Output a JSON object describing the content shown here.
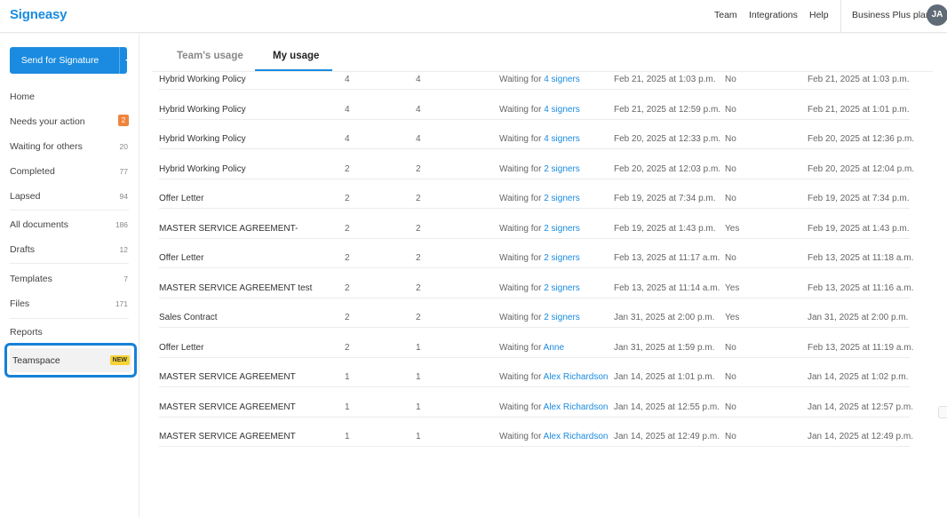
{
  "app": {
    "logo": "Signeasy",
    "nav": {
      "team": "Team",
      "integrations": "Integrations",
      "help": "Help"
    },
    "plan": "Business Plus plan",
    "avatar_initials": "JA"
  },
  "sidebar": {
    "send_button": "Send for Signature",
    "items": [
      {
        "label": "Home",
        "count": ""
      },
      {
        "label": "Needs your action",
        "count": "2"
      },
      {
        "label": "Waiting for others",
        "count": "20"
      },
      {
        "label": "Completed",
        "count": "77"
      },
      {
        "label": "Lapsed",
        "count": "94"
      },
      {
        "label": "All documents",
        "count": "186"
      },
      {
        "label": "Drafts",
        "count": "12"
      },
      {
        "label": "Templates",
        "count": "7"
      },
      {
        "label": "Files",
        "count": "171"
      },
      {
        "label": "Reports",
        "count": ""
      }
    ],
    "teamspace": {
      "label": "Teamspace",
      "badge": "NEW"
    }
  },
  "tabs": {
    "team_usage": "Team's usage",
    "my_usage": "My usage"
  },
  "colors": {
    "accent": "#1a8be0",
    "badge_orange": "#f0843c",
    "new_badge": "#f7d334",
    "highlight_border": "#1581d8"
  },
  "table": {
    "rows": [
      {
        "doc": "Hybrid Working Policy",
        "a": "4",
        "b": "4",
        "status_prefix": "Waiting for",
        "status_link": "4 signers",
        "sent": "Feb 21, 2025 at 1:03 p.m.",
        "flag": "No",
        "updated": "Feb 21, 2025 at 1:03 p.m."
      },
      {
        "doc": "Hybrid Working Policy",
        "a": "4",
        "b": "4",
        "status_prefix": "Waiting for",
        "status_link": "4 signers",
        "sent": "Feb 21, 2025 at 12:59 p.m.",
        "flag": "No",
        "updated": "Feb 21, 2025 at 1:01 p.m."
      },
      {
        "doc": "Hybrid Working Policy",
        "a": "4",
        "b": "4",
        "status_prefix": "Waiting for",
        "status_link": "4 signers",
        "sent": "Feb 20, 2025 at 12:33 p.m.",
        "flag": "No",
        "updated": "Feb 20, 2025 at 12:36 p.m."
      },
      {
        "doc": "Hybrid Working Policy",
        "a": "2",
        "b": "2",
        "status_prefix": "Waiting for",
        "status_link": "2 signers",
        "sent": "Feb 20, 2025 at 12:03 p.m.",
        "flag": "No",
        "updated": "Feb 20, 2025 at 12:04 p.m."
      },
      {
        "doc": "Offer Letter",
        "a": "2",
        "b": "2",
        "status_prefix": "Waiting for",
        "status_link": "2 signers",
        "sent": "Feb 19, 2025 at 7:34 p.m.",
        "flag": "No",
        "updated": "Feb 19, 2025 at 7:34 p.m."
      },
      {
        "doc": "MASTER SERVICE AGREEMENT-",
        "a": "2",
        "b": "2",
        "status_prefix": "Waiting for",
        "status_link": "2 signers",
        "sent": "Feb 19, 2025 at 1:43 p.m.",
        "flag": "Yes",
        "updated": "Feb 19, 2025 at 1:43 p.m."
      },
      {
        "doc": "Offer Letter",
        "a": "2",
        "b": "2",
        "status_prefix": "Waiting for",
        "status_link": "2 signers",
        "sent": "Feb 13, 2025 at 11:17 a.m.",
        "flag": "No",
        "updated": "Feb 13, 2025 at 11:18 a.m."
      },
      {
        "doc": "MASTER SERVICE AGREEMENT test",
        "a": "2",
        "b": "2",
        "status_prefix": "Waiting for",
        "status_link": "2 signers",
        "sent": "Feb 13, 2025 at 11:14 a.m.",
        "flag": "Yes",
        "updated": "Feb 13, 2025 at 11:16 a.m."
      },
      {
        "doc": "Sales Contract",
        "a": "2",
        "b": "2",
        "status_prefix": "Waiting for",
        "status_link": "2 signers",
        "sent": "Jan 31, 2025 at 2:00 p.m.",
        "flag": "Yes",
        "updated": "Jan 31, 2025 at 2:00 p.m."
      },
      {
        "doc": "Offer Letter",
        "a": "2",
        "b": "1",
        "status_prefix": "Waiting for",
        "status_link": "Anne",
        "sent": "Jan 31, 2025 at 1:59 p.m.",
        "flag": "No",
        "updated": "Feb 13, 2025 at 11:19 a.m."
      },
      {
        "doc": "MASTER SERVICE AGREEMENT",
        "a": "1",
        "b": "1",
        "status_prefix": "Waiting for",
        "status_link": "Alex Richardson",
        "sent": "Jan 14, 2025 at 1:01 p.m.",
        "flag": "No",
        "updated": "Jan 14, 2025 at 1:02 p.m."
      },
      {
        "doc": "MASTER SERVICE AGREEMENT",
        "a": "1",
        "b": "1",
        "status_prefix": "Waiting for",
        "status_link": "Alex Richardson",
        "sent": "Jan 14, 2025 at 12:55 p.m.",
        "flag": "No",
        "updated": "Jan 14, 2025 at 12:57 p.m."
      },
      {
        "doc": "MASTER SERVICE AGREEMENT",
        "a": "1",
        "b": "1",
        "status_prefix": "Waiting for",
        "status_link": "Alex Richardson",
        "sent": "Jan 14, 2025 at 12:49 p.m.",
        "flag": "No",
        "updated": "Jan 14, 2025 at 12:49 p.m."
      }
    ]
  }
}
